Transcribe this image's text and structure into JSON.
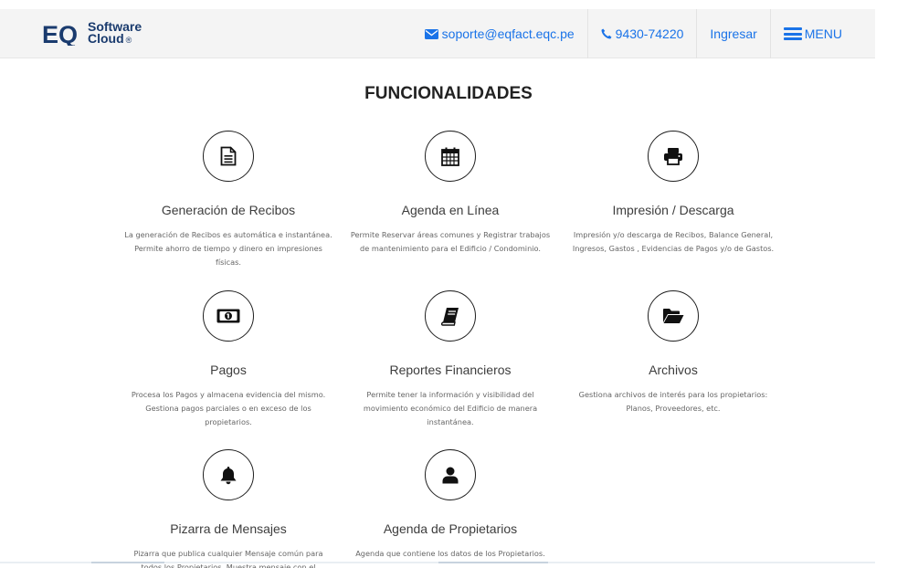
{
  "header": {
    "logo": {
      "mark": "EQ",
      "line1": "Software",
      "line2": "Cloud",
      "reg": "®",
      "icon": "eq-logo-icon"
    },
    "email": {
      "label": "soporte@eqfact.eqc.pe",
      "icon": "envelope-icon"
    },
    "phone": {
      "label": "9430-74220",
      "icon": "phone-icon"
    },
    "login": {
      "label": "Ingresar"
    },
    "menu": {
      "label": "MENU",
      "icon": "hamburger-icon"
    },
    "link_color": "#1a73e8"
  },
  "page_title": "FUNCIONALIDADES",
  "features": [
    {
      "icon": "document-icon",
      "title": "Generación de Recibos",
      "desc": "La generación de Recibos es automática e instantánea. Permite ahorro de tiempo y dinero en impresiones físicas."
    },
    {
      "icon": "calendar-icon",
      "title": "Agenda en Línea",
      "desc": "Permite Reservar áreas comunes y Registrar trabajos de mantenimiento para el Edificio / Condominio."
    },
    {
      "icon": "printer-icon",
      "title": "Impresión / Descarga",
      "desc": "Impresión y/o descarga de Recibos, Balance General, Ingresos, Gastos , Evidencias de Pagos y/o de Gastos."
    },
    {
      "icon": "money-bill-icon",
      "title": "Pagos",
      "desc": "Procesa los Pagos y almacena evidencia del mismo. Gestiona pagos parciales o en exceso de los propietarios."
    },
    {
      "icon": "book-icon",
      "title": "Reportes Financieros",
      "desc": "Permite tener la información y visibilidad del movimiento económico del Edificio de manera instantánea."
    },
    {
      "icon": "folder-open-icon",
      "title": "Archivos",
      "desc": "Gestiona archivos de interés para los propietarios: Planos, Proveedores, etc."
    },
    {
      "icon": "bell-icon",
      "title": "Pizarra de Mensajes",
      "desc": "Pizarra que publica cualquier Mensaje común para todos los Propietarios. Muestra mensaje con el"
    },
    {
      "icon": "user-icon",
      "title": "Agenda de Propietarios",
      "desc": "Agenda que contiene los datos de los Propietarios."
    }
  ]
}
